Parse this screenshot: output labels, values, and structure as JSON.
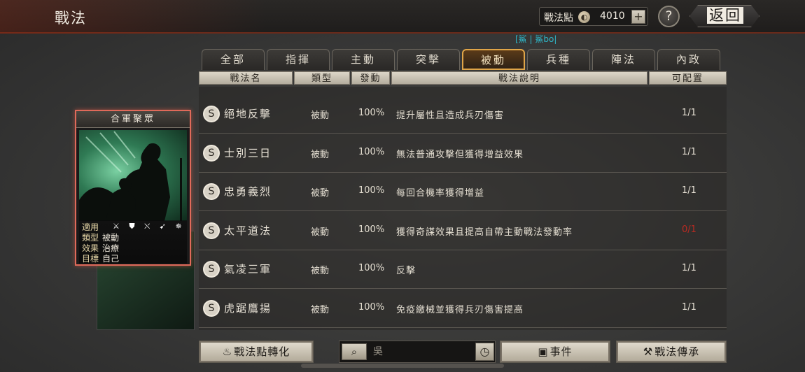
{
  "header": {
    "title": "戰法",
    "points_label": "戰法點",
    "points_value": "4010",
    "plus": "+",
    "help": "?",
    "back": "返回",
    "ticker": "[鯊 | 鯊bo|"
  },
  "tabs": [
    {
      "label": "全部"
    },
    {
      "label": "指揮"
    },
    {
      "label": "主動"
    },
    {
      "label": "突擊"
    },
    {
      "label": "被動",
      "active": true
    },
    {
      "label": "兵種"
    },
    {
      "label": "陣法"
    },
    {
      "label": "內政"
    }
  ],
  "columns": {
    "name": "戰法名",
    "type": "類型",
    "trigger": "發動",
    "desc": "戰法說明",
    "slots": "可配置"
  },
  "tactics": [
    {
      "grade": "S",
      "name": "絕地反擊",
      "type": "被動",
      "rate": "100%",
      "desc": "提升屬性且造成兵刃傷害",
      "slots": "1/1"
    },
    {
      "grade": "S",
      "name": "士別三日",
      "type": "被動",
      "rate": "100%",
      "desc": "無法普通攻擊但獲得增益效果",
      "slots": "1/1"
    },
    {
      "grade": "S",
      "name": "忠勇義烈",
      "type": "被動",
      "rate": "100%",
      "desc": "每回合機率獲得增益",
      "slots": "1/1"
    },
    {
      "grade": "S",
      "name": "太平道法",
      "type": "被動",
      "rate": "100%",
      "desc": "獲得奇謀效果且提高自帶主動戰法發動率",
      "slots": "0/1",
      "empty": true
    },
    {
      "grade": "S",
      "name": "氣凌三軍",
      "type": "被動",
      "rate": "100%",
      "desc": "反擊",
      "slots": "1/1"
    },
    {
      "grade": "S",
      "name": "虎踞鷹揚",
      "type": "被動",
      "rate": "100%",
      "desc": "免疫繳械並獲得兵刃傷害提高",
      "slots": "1/1"
    }
  ],
  "card": {
    "title": "合軍聚眾",
    "applies_label": "適用",
    "applies_icons": "⚔ ⛊ ⛌ ➹ ✵",
    "type_label": "類型",
    "type_value": "被動",
    "effect_label": "效果",
    "effect_value": "治療",
    "target_label": "目標",
    "target_value": "自己"
  },
  "bottom": {
    "convert": "戰法點轉化",
    "search_value": "吳",
    "events": "事件",
    "inherit": "戰法傳承"
  }
}
